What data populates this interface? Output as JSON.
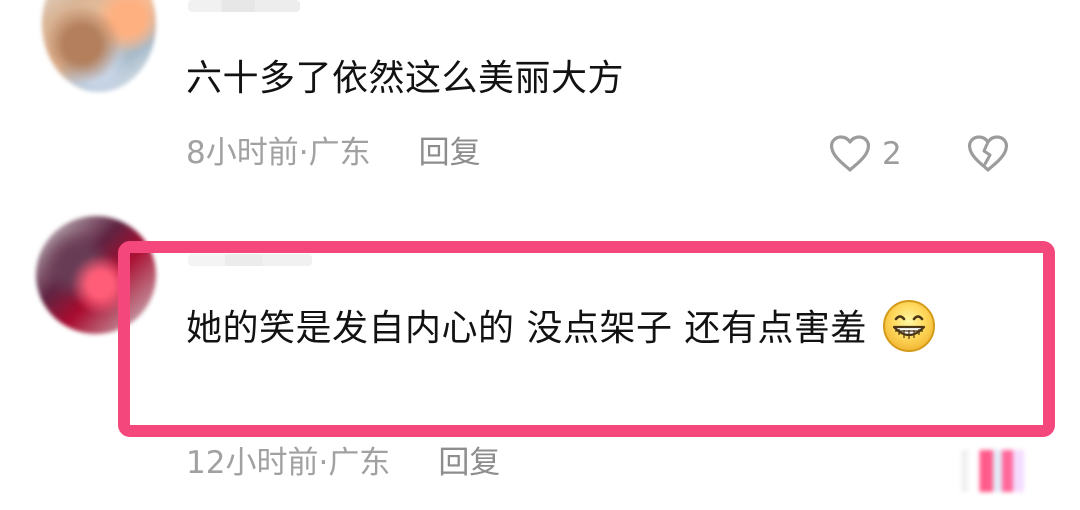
{
  "comments": [
    {
      "text": "六十多了依然这么美丽大方",
      "time": "8小时前",
      "separator": " · ",
      "location": "广东",
      "reply_label": "回复",
      "like_count": "2"
    },
    {
      "text": "她的笑是发自内心的   没点架子  还有点害羞",
      "time": "12小时前",
      "separator": " · ",
      "location": "广东",
      "reply_label": "回复"
    }
  ],
  "icons": {
    "like": "heart-icon",
    "dislike": "broken-heart-icon",
    "emoji": "grinning-face-icon"
  },
  "colors": {
    "highlight": "#f4487d",
    "text": "#121212",
    "meta": "#a1a1a1"
  }
}
